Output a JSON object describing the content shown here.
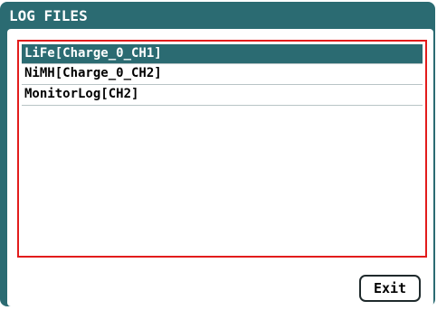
{
  "window": {
    "title": "LOG FILES"
  },
  "files": [
    {
      "label": "LiFe[Charge_0_CH1]",
      "selected": true
    },
    {
      "label": "NiMH[Charge_0_CH2]",
      "selected": false
    },
    {
      "label": "MonitorLog[CH2]",
      "selected": false
    }
  ],
  "footer": {
    "exit_label": "Exit"
  },
  "colors": {
    "frame": "#2b6b72",
    "selection": "#2b6b72",
    "list_border": "#e21c1c",
    "panel": "#ffffff"
  }
}
